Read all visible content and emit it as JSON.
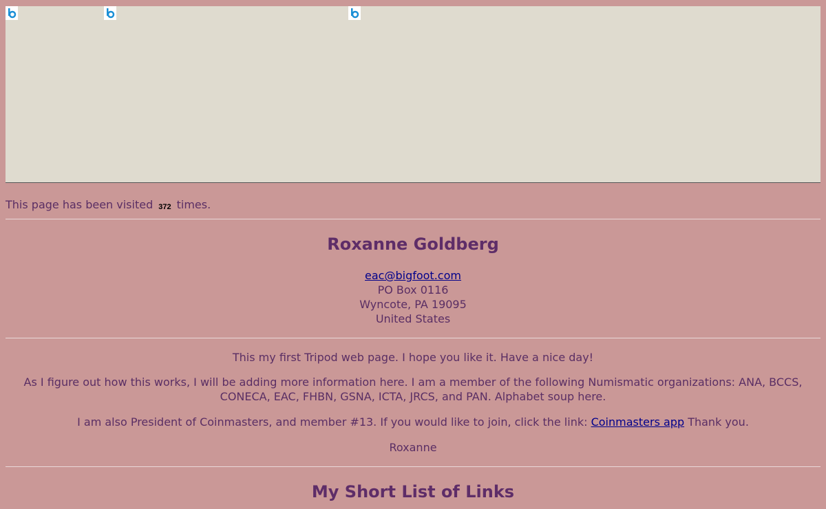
{
  "visit": {
    "prefix": "This page has been visited",
    "count": "372",
    "suffix": "times."
  },
  "profile": {
    "name": "Roxanne Goldberg",
    "email": "eac@bigfoot.com",
    "address_line1": "PO Box 0116",
    "address_line2": "Wyncote, PA 19095",
    "country": "United States"
  },
  "content": {
    "p1": "This my first Tripod web page. I hope you like it. Have a nice day!",
    "p2": "As I figure out how this works, I will be adding more information here. I am a member of the following Numismatic organizations: ANA, BCCS, CONECA, EAC, FHBN, GSNA, ICTA, JRCS, and PAN. Alphabet soup here.",
    "p3_before": "I am also President of Coinmasters, and member #13. If you would like to join, click the link:",
    "p3_link": "Coinmasters app",
    "p3_after": "Thank you.",
    "signature": "Roxanne"
  },
  "links": {
    "title": "My Short List of Links"
  }
}
